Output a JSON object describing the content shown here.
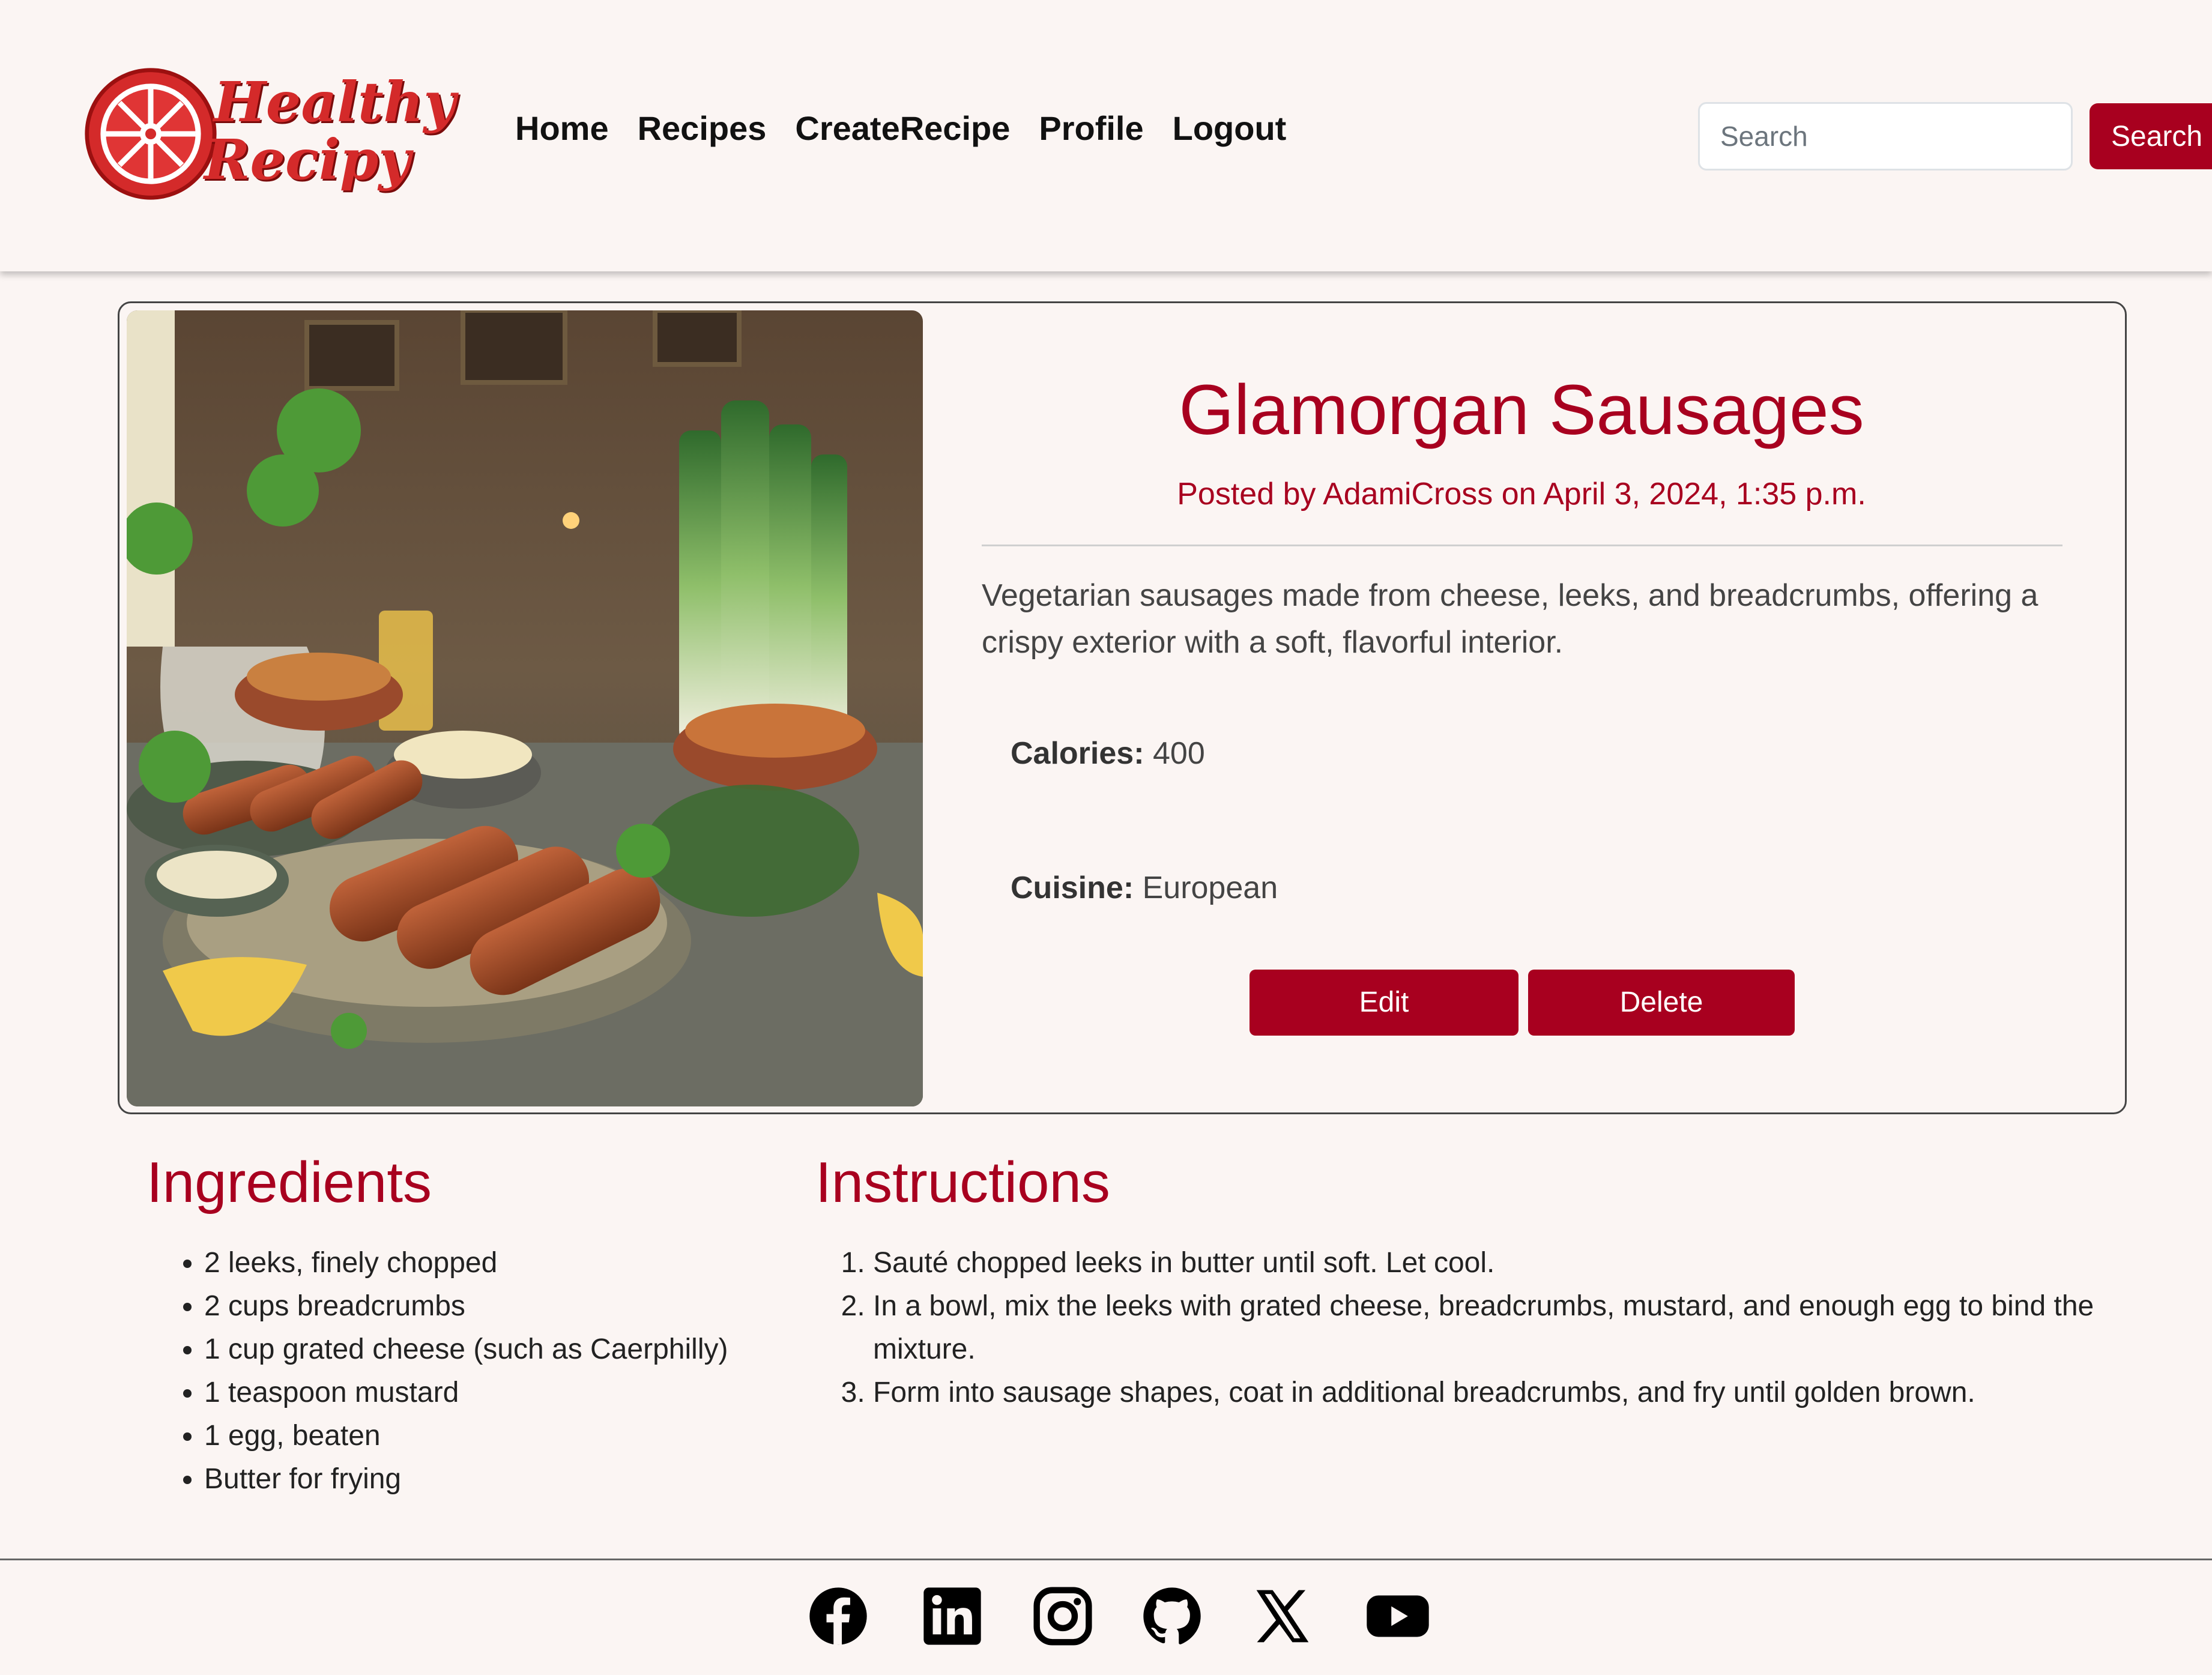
{
  "nav": {
    "brand_line1": "Healthy",
    "brand_line2": "Recipy",
    "links": [
      "Home",
      "Recipes",
      "CreateRecipe",
      "Profile",
      "Logout"
    ],
    "search_placeholder": "Search",
    "search_button": "Search"
  },
  "recipe": {
    "title": "Glamorgan Sausages",
    "posted_by": "Posted by AdamiCross on April 3, 2024, 1:35 p.m.",
    "description": "Vegetarian sausages made from cheese, leeks, and breadcrumbs, offering a crispy exterior with a soft, flavorful interior.",
    "calories_label": "Calories:",
    "calories_value": "400",
    "cuisine_label": "Cuisine:",
    "cuisine_value": "European",
    "edit_label": "Edit",
    "delete_label": "Delete"
  },
  "ingredients": {
    "heading": "Ingredients",
    "items": [
      "2 leeks, finely chopped",
      "2 cups breadcrumbs",
      "1 cup grated cheese (such as Caerphilly)",
      "1 teaspoon mustard",
      "1 egg, beaten",
      "Butter for frying"
    ]
  },
  "instructions": {
    "heading": "Instructions",
    "steps": [
      "Sauté chopped leeks in butter until soft. Let cool.",
      "In a bowl, mix the leeks with grated cheese, breadcrumbs, mustard, and enough egg to bind the mixture.",
      "Form into sausage shapes, coat in additional breadcrumbs, and fry until golden brown."
    ]
  },
  "footer": {
    "icons": [
      "facebook-icon",
      "linkedin-icon",
      "instagram-icon",
      "github-icon",
      "x-icon",
      "youtube-icon"
    ]
  },
  "colors": {
    "brand_red": "#a8001f",
    "background": "#fbf5f3",
    "logo_red": "#d42a2a"
  }
}
